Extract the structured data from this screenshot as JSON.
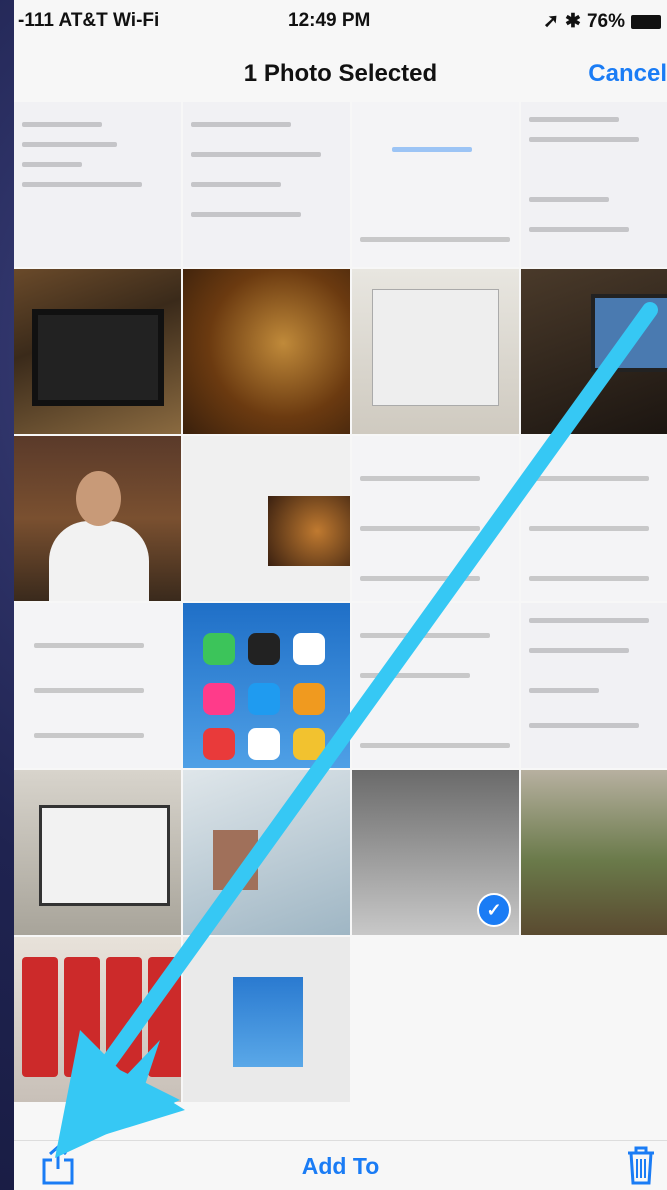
{
  "status_bar": {
    "carrier": "-111 AT&T Wi-Fi",
    "time": "12:49 PM",
    "battery": "76%"
  },
  "nav": {
    "title": "1 Photo Selected",
    "cancel_label": "Cancel"
  },
  "toolbar": {
    "add_to_label": "Add To"
  },
  "icons": {
    "share": "share-icon",
    "trash": "trash-icon",
    "wifi": "wifi-icon",
    "location": "location-arrow-icon",
    "bluetooth": "bluetooth-icon",
    "selected": "checkmark-icon"
  },
  "colors": {
    "accent": "#1a7cf5",
    "annotation_arrow": "#36c8f4"
  },
  "selection": {
    "selected_count": 1
  }
}
